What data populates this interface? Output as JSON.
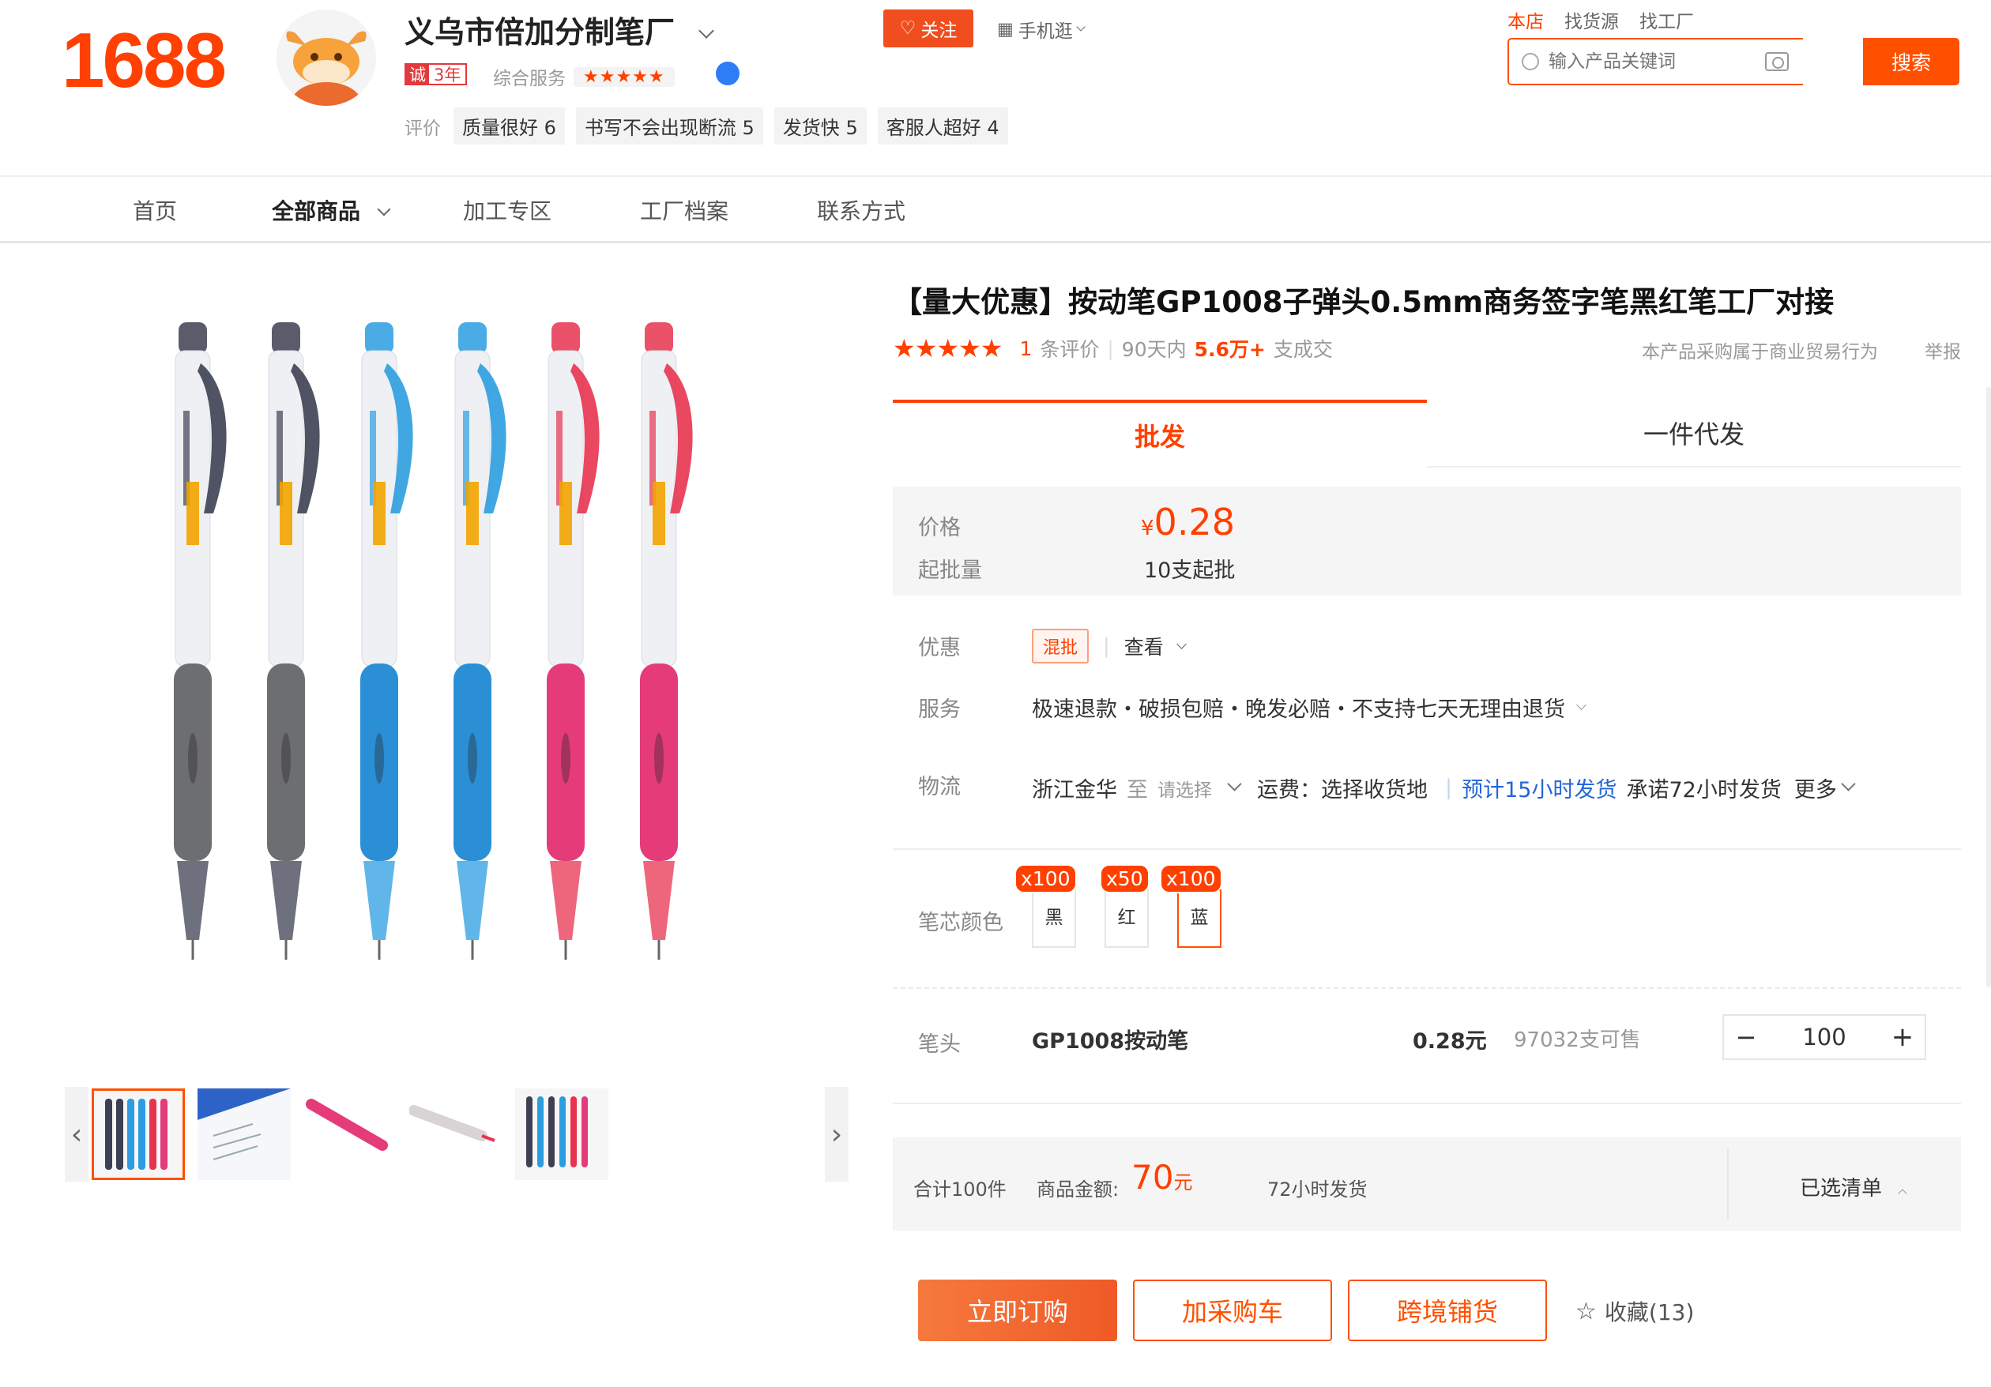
{
  "brand": {
    "logo_text": "1688"
  },
  "shop": {
    "name": "义乌市倍加分制笔厂",
    "integrity_prefix": "诚",
    "integrity_years": "3年",
    "service_label": "综合服务",
    "service_stars": "★★★★★",
    "rating_label": "评价",
    "tags": [
      "质量很好 6",
      "书写不会出现断流 5",
      "发货快 5",
      "客服人超好 4"
    ],
    "follow_label": "关注",
    "mobile_label": "手机逛"
  },
  "search": {
    "scopes": [
      "本店",
      "找货源",
      "找工厂"
    ],
    "placeholder": "输入产品关键词",
    "button_label": "搜索"
  },
  "nav": {
    "items": [
      "首页",
      "全部商品",
      "加工专区",
      "工厂档案",
      "联系方式"
    ]
  },
  "product": {
    "title": "【量大优惠】按动笔GP1008子弹头0.5mm商务签字笔黑红笔工厂对接",
    "stars": "★★★★★",
    "review_count": "1",
    "review_unit": "条评价",
    "sales_prefix": "90天内",
    "sales_value": "5.6万+",
    "sales_suffix": "支成交",
    "trade_note": "本产品采购属于商业贸易行为",
    "report_label": "举报"
  },
  "tabs": {
    "active": "批发",
    "other": "一件代发"
  },
  "pricing": {
    "price_label": "价格",
    "currency": "¥",
    "price": "0.28",
    "moq_label": "起批量",
    "moq": "10支起批"
  },
  "promo": {
    "label": "优惠",
    "tag": "混批",
    "view": "查看"
  },
  "service": {
    "label": "服务",
    "text": "极速退款・破损包赔・晚发必赔・不支持七天无理由退货"
  },
  "logistics": {
    "label": "物流",
    "origin": "浙江金华",
    "to": "至",
    "select": "请选择",
    "freight_label": "运费：",
    "freight_value": "选择收货地",
    "eta": "预计15小时发货",
    "promise": "承诺72小时发货",
    "more": "更多"
  },
  "colors": {
    "label": "笔芯颜色",
    "options": [
      {
        "name": "黑",
        "badge": "x100"
      },
      {
        "name": "红",
        "badge": "x50"
      },
      {
        "name": "蓝",
        "badge": "x100"
      }
    ]
  },
  "sku": {
    "label": "笔头",
    "name": "GP1008按动笔",
    "price": "0.28元",
    "stock": "97032支可售",
    "quantity": "100",
    "minus": "−",
    "plus": "+"
  },
  "summary": {
    "total_count": "合计100件",
    "amount_label": "商品金额:",
    "amount": "70",
    "amount_unit": "元",
    "ship": "72小时发货",
    "list_label": "已选清单"
  },
  "actions": {
    "order": "立即订购",
    "cart": "加采购车",
    "crossborder": "跨境铺货",
    "favorite": "收藏(13)"
  },
  "colors_theme": {
    "accent": "#ff4000",
    "link": "#2165d9"
  },
  "pens": [
    {
      "barrel": "#3d4052",
      "grip": "#6d6e72"
    },
    {
      "barrel": "#3d4052",
      "grip": "#6d6e72"
    },
    {
      "barrel": "#2b9de0",
      "grip": "#2b8fd6"
    },
    {
      "barrel": "#2b9de0",
      "grip": "#2b8fd6"
    },
    {
      "barrel": "#e8334f",
      "grip": "#e53b79"
    },
    {
      "barrel": "#e8334f",
      "grip": "#e53b79"
    }
  ]
}
